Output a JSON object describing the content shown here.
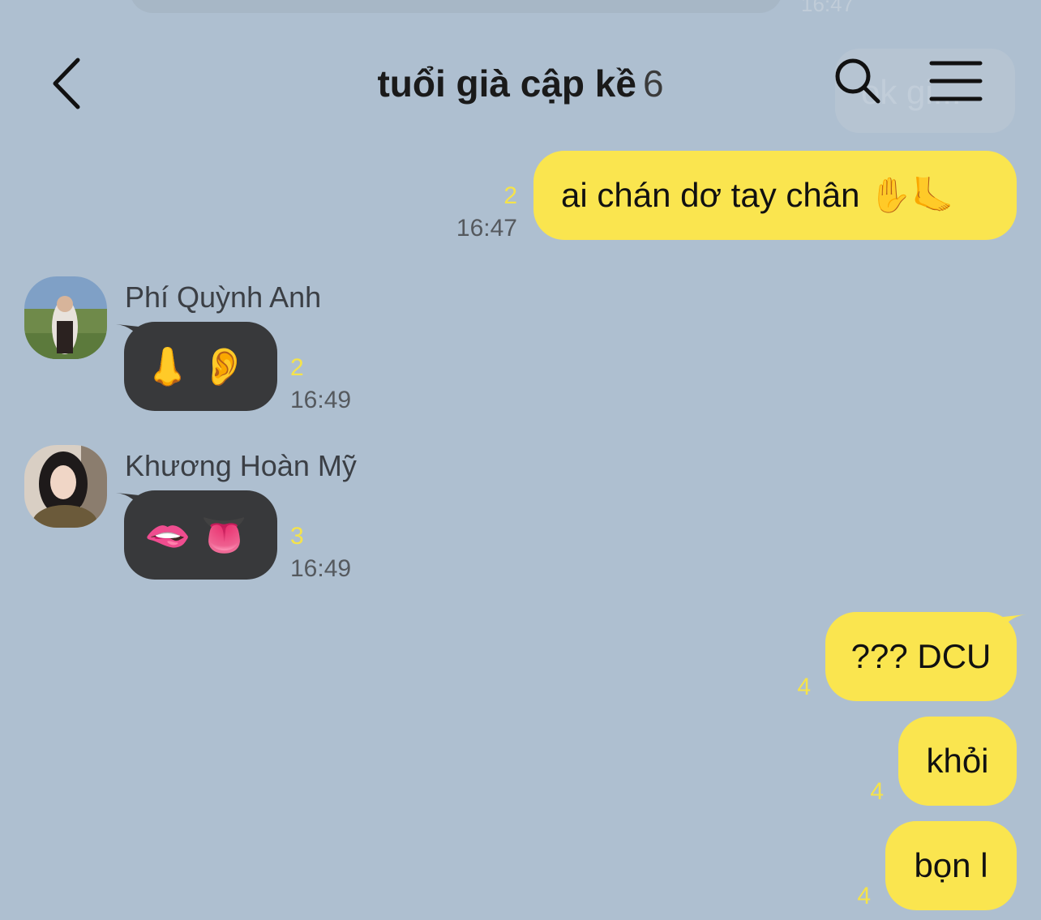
{
  "header": {
    "title": "tuổi già cập kề",
    "member_count": "6"
  },
  "background_fragments": {
    "time": "16:47",
    "bubble_text": "ok gi..."
  },
  "messages": [
    {
      "side": "me",
      "text": "ai chán dơ tay chân ✋🦶",
      "unread": "2",
      "time": "16:47"
    },
    {
      "side": "other",
      "sender": "Phí Quỳnh Anh",
      "text": "👃👂",
      "unread": "2",
      "time": "16:49"
    },
    {
      "side": "other",
      "sender": "Khương Hoàn Mỹ",
      "text": "🫦👅",
      "unread": "3",
      "time": "16:49"
    },
    {
      "side": "me",
      "text": "??? DCU",
      "unread": "4"
    },
    {
      "side": "me",
      "text": "khỏi",
      "unread": "4"
    },
    {
      "side": "me",
      "text": "bọn l",
      "unread": "4"
    }
  ],
  "colors": {
    "background": "#aebfd0",
    "my_bubble": "#fae54f",
    "other_bubble": "#38393b",
    "unread": "#f5e34a"
  }
}
